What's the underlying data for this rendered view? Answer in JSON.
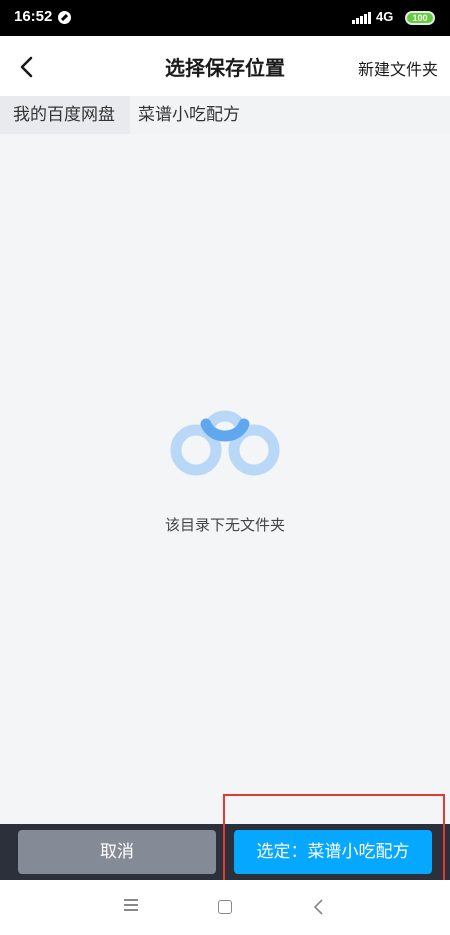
{
  "status_bar": {
    "time": "16:52",
    "network": "4G",
    "battery": "100"
  },
  "header": {
    "title": "选择保存位置",
    "new_folder_label": "新建文件夹",
    "back_icon": "chevron-left-icon"
  },
  "breadcrumb": {
    "root": "我的百度网盘",
    "current": "菜谱小吃配方"
  },
  "content": {
    "empty_message": "该目录下无文件夹",
    "empty_icon": "baidu-cloud-icon"
  },
  "actions": {
    "cancel_label": "取消",
    "select_label": "选定：菜谱小吃配方"
  },
  "colors": {
    "primary": "#06a7ff",
    "cancel": "#858b96",
    "bottom_bar": "#2b303a",
    "highlight": "#e53935"
  }
}
